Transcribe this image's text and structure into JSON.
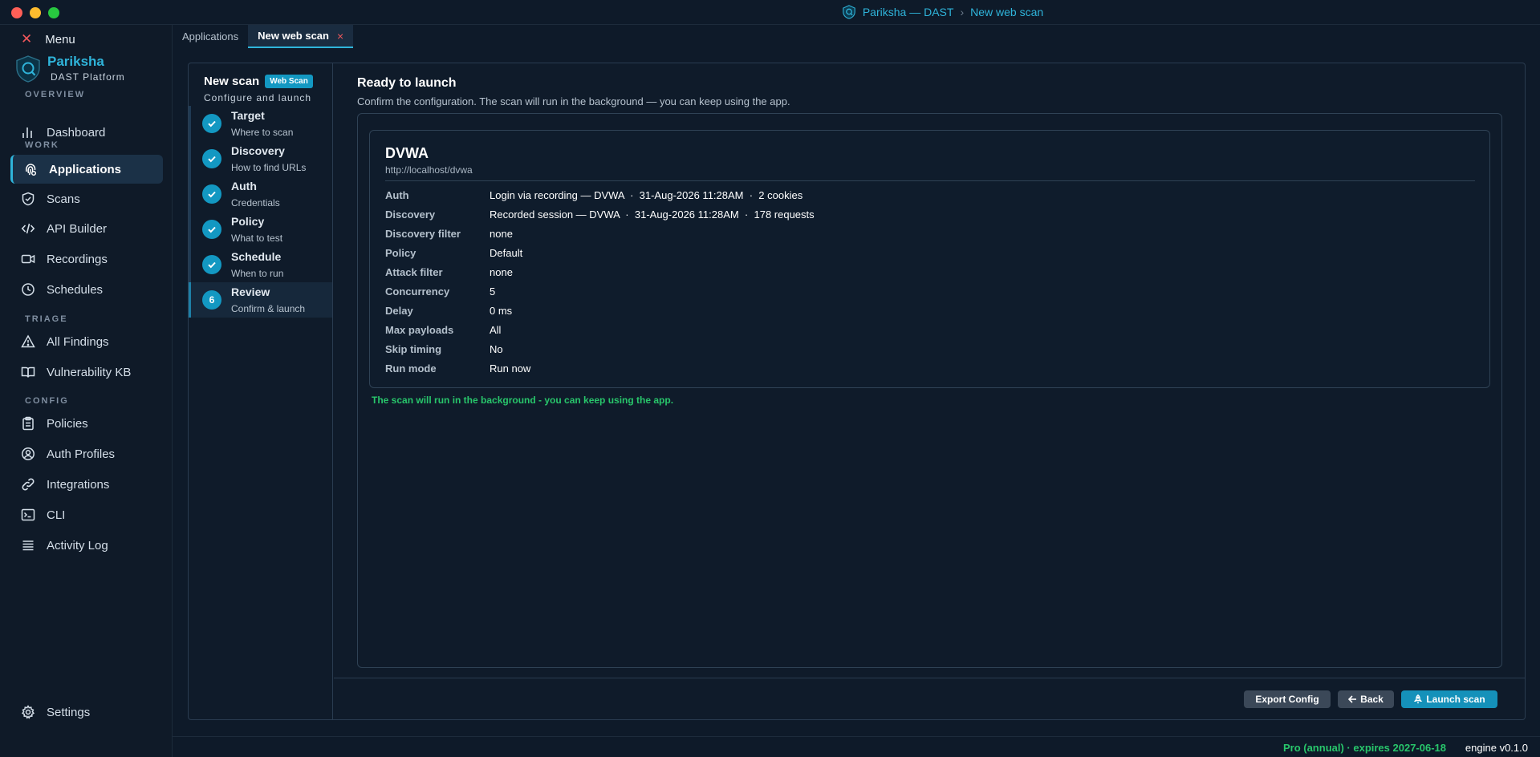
{
  "window": {
    "title_app": "Pariksha — DAST",
    "title_sep": "›",
    "title_page": "New web scan"
  },
  "sidebar": {
    "menu_label": "Menu",
    "brand_name": "Pariksha",
    "brand_sub": "DAST Platform",
    "sections": {
      "overview": "OVERVIEW",
      "work": "WORK",
      "triage": "TRIAGE",
      "config": "CONFIG"
    },
    "items": {
      "dashboard": "Dashboard",
      "applications": "Applications",
      "scans": "Scans",
      "api_builder": "API Builder",
      "recordings": "Recordings",
      "schedules": "Schedules",
      "all_findings": "All Findings",
      "vulnerability_kb": "Vulnerability KB",
      "policies": "Policies",
      "auth_profiles": "Auth Profiles",
      "integrations": "Integrations",
      "cli": "CLI",
      "activity_log": "Activity Log",
      "settings": "Settings"
    }
  },
  "tabs": [
    {
      "label": "Applications"
    },
    {
      "label": "New web scan",
      "close": "×"
    }
  ],
  "wizard": {
    "title": "New scan",
    "badge": "Web Scan",
    "subtitle": "Configure and launch",
    "steps": [
      {
        "name": "Target",
        "desc": "Where to scan"
      },
      {
        "name": "Discovery",
        "desc": "How to find URLs"
      },
      {
        "name": "Auth",
        "desc": "Credentials"
      },
      {
        "name": "Policy",
        "desc": "What to test"
      },
      {
        "name": "Schedule",
        "desc": "When to run"
      },
      {
        "name": "Review",
        "desc": "Confirm & launch",
        "number": "6"
      }
    ]
  },
  "review": {
    "title": "Ready to launch",
    "subtitle": "Confirm the configuration. The scan will run in the background — you can keep using the app.",
    "app_name": "DVWA",
    "app_url": "http://localhost/dvwa",
    "rows": [
      {
        "key": "Auth",
        "value": "Login via recording — DVWA  ·  31-Aug-2026 11:28AM  ·  2 cookies"
      },
      {
        "key": "Discovery",
        "value": "Recorded session — DVWA  ·  31-Aug-2026 11:28AM  ·  178 requests"
      },
      {
        "key": "Discovery filter",
        "value": "none"
      },
      {
        "key": "Policy",
        "value": "Default"
      },
      {
        "key": "Attack filter",
        "value": "none"
      },
      {
        "key": "Concurrency",
        "value": "5"
      },
      {
        "key": "Delay",
        "value": "0 ms"
      },
      {
        "key": "Max payloads",
        "value": "All"
      },
      {
        "key": "Skip timing",
        "value": "No"
      },
      {
        "key": "Run mode",
        "value": "Run now"
      }
    ],
    "background_note": "The scan will run in the background - you can keep using the app."
  },
  "buttons": {
    "export": "Export Config",
    "back": "Back",
    "launch": "Launch scan"
  },
  "status": {
    "license": "Pro (annual) · expires 2027-06-18",
    "engine": "engine v0.1.0"
  },
  "colors": {
    "accent": "#2fb4da",
    "primary_button": "#1591ba",
    "success": "#28c66b",
    "close": "#f0575b"
  }
}
